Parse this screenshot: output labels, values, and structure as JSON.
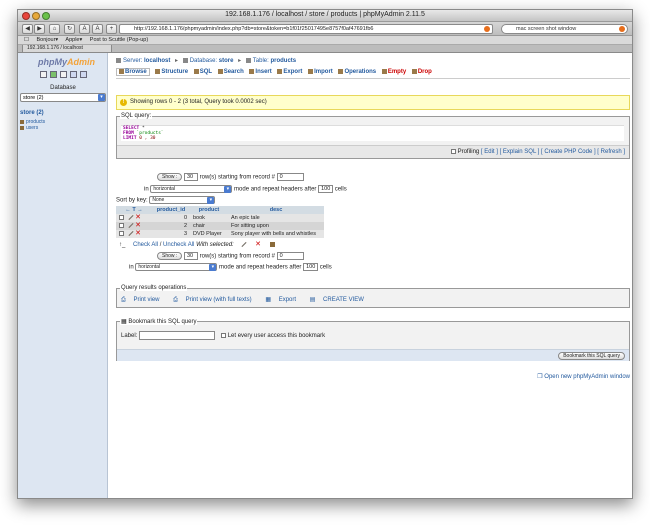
{
  "window": {
    "title": "192.168.1.176 / localhost / store / products | phpMyAdmin 2.11.5"
  },
  "browser": {
    "url": "http://192.168.1.176/phpmyadmin/index.php?db=store&token=b1f01f25017495e8757f0af47691fb6",
    "search_value": "mac screen shot window",
    "bookmarks": [
      "Bonjour▾",
      "Apple▾",
      "Post to Scuttle (Pop-up)"
    ],
    "tab_label": "192.168.1.176 / localhost"
  },
  "sidebar": {
    "logo_main": "phpMy",
    "logo_accent": "Admin",
    "database_label": "Database",
    "database_select": "store (2)",
    "db_link": "store (2)",
    "tables": [
      "products",
      "users"
    ]
  },
  "breadcrumb": {
    "server_label": "Server:",
    "server": "localhost",
    "database_label": "Database:",
    "database": "store",
    "table_label": "Table:",
    "table": "products"
  },
  "tabs": [
    "Browse",
    "Structure",
    "SQL",
    "Search",
    "Insert",
    "Export",
    "Import",
    "Operations",
    "Empty",
    "Drop"
  ],
  "notice": {
    "text": "Showing rows 0 - 2 (3 total, Query took 0.0002 sec)"
  },
  "sql_box": {
    "legend": "SQL query:",
    "line1_kw": "SELECT",
    "line1_rest": " *",
    "line2_kw": "FROM",
    "line2_rest": " `products`",
    "line3_kw": "LIMIT",
    "line3_num": " 0 , 30",
    "profiling": "Profiling",
    "links": "[ Edit ] [ Explain SQL ] [ Create PHP Code ] [ Refresh ]"
  },
  "nav_top": {
    "show_button": "Show :",
    "rows_value": "30",
    "rows_text": "row(s) starting from record #",
    "start_value": "0",
    "in_label": "in",
    "mode_select": "horizontal",
    "mode_text": "mode and repeat headers after",
    "repeat_value": "100",
    "cells_text": "cells"
  },
  "sort": {
    "label": "Sort by key:",
    "select": "None"
  },
  "table": {
    "headers": [
      "product_id",
      "product",
      "desc"
    ],
    "rows": [
      {
        "id": "0",
        "product": "book",
        "desc": "An epic tale"
      },
      {
        "id": "2",
        "product": "chair",
        "desc": "For sitting upon"
      },
      {
        "id": "3",
        "product": "DVD Player",
        "desc": "Sony player with bells and whistles"
      }
    ],
    "check_all": "Check All",
    "separator": " / ",
    "uncheck_all": "Uncheck All",
    "with_selected": "With selected:"
  },
  "nav_bottom": {
    "show_button": "Show :",
    "rows_value": "30",
    "rows_text": "row(s) starting from record #",
    "start_value": "0",
    "in_label": "in",
    "mode_select": "horizontal",
    "mode_text": "mode and repeat headers after",
    "repeat_value": "100",
    "cells_text": "cells"
  },
  "query_results": {
    "legend": "Query results operations",
    "print_view": "Print view",
    "print_full": "Print view (with full texts)",
    "export": "Export",
    "create_view": "CREATE VIEW"
  },
  "bookmark": {
    "legend": "Bookmark this SQL query",
    "label": "Label:",
    "let_every": "Let every user access this bookmark",
    "button": "Bookmark this SQL query"
  },
  "new_window": "Open new phpMyAdmin window"
}
